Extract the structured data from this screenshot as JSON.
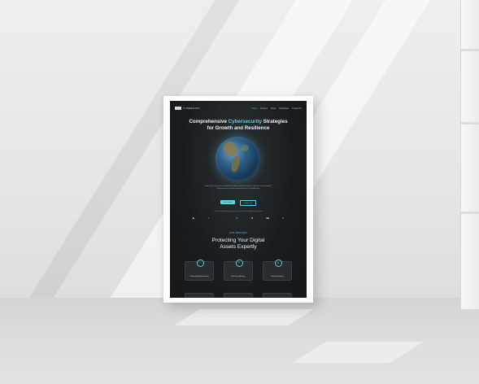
{
  "poster": {
    "nav": {
      "logo_text": "CYBERSHIFT",
      "menu": [
        "Home",
        "Services",
        "About",
        "Certificates",
        "Contact Us"
      ]
    },
    "hero": {
      "title_before": "Comprehensive ",
      "title_accent": "Cybersecurity",
      "title_after": " Strategies",
      "title_line2": "for Growth and Resilience",
      "description": "Unlock your business's full potential with our comprehensive cybersecurity strategies. Safeguard your growth and resilience in the digital age.",
      "primary_button": "Get Started",
      "secondary_button": "Contact Us"
    },
    "trust_text": "We are trusted by global brands to protect their critical digital infrastructure",
    "brands": [
      "▶",
      "✓",
      "",
      "▭",
      "❖",
      "■■",
      "●"
    ],
    "services": {
      "label": "OUR SERVICES",
      "title_line1": "Protecting Your Digital",
      "title_line2": "Assets Expertly",
      "cards": [
        {
          "icon": "⚿",
          "label": "Vulnerability Assessment"
        },
        {
          "icon": "⛨",
          "label": "Red Team Activity"
        },
        {
          "icon": "◍",
          "label": "Pentest Services"
        }
      ]
    },
    "colors": {
      "accent": "#5fd4e6",
      "background": "#1b1e20"
    }
  }
}
